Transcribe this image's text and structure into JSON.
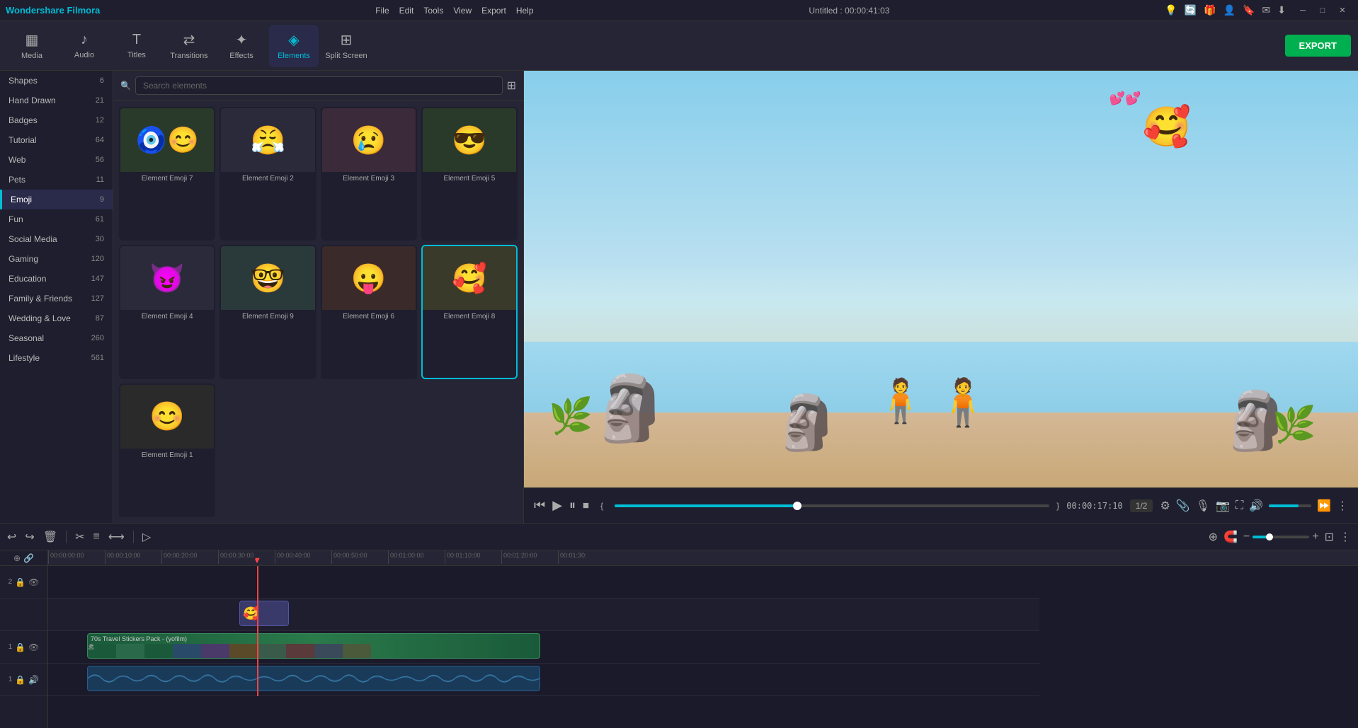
{
  "app": {
    "name": "Wondershare Filmora",
    "title": "Untitled : 00:00:41:03",
    "version": "Filmora"
  },
  "menu": {
    "items": [
      "File",
      "Edit",
      "Tools",
      "View",
      "Export",
      "Help"
    ]
  },
  "toolbar": {
    "items": [
      {
        "id": "media",
        "label": "Media",
        "icon": "▦"
      },
      {
        "id": "audio",
        "label": "Audio",
        "icon": "♪"
      },
      {
        "id": "titles",
        "label": "Titles",
        "icon": "T"
      },
      {
        "id": "transitions",
        "label": "Transitions",
        "icon": "⇄"
      },
      {
        "id": "effects",
        "label": "Effects",
        "icon": "✦"
      },
      {
        "id": "elements",
        "label": "Elements",
        "icon": "◈"
      },
      {
        "id": "splitscreen",
        "label": "Split Screen",
        "icon": "⊞"
      }
    ],
    "active": "elements",
    "export_label": "EXPORT"
  },
  "categories": [
    {
      "id": "shapes",
      "label": "Shapes",
      "count": 6
    },
    {
      "id": "handdrawn",
      "label": "Hand Drawn",
      "count": 21
    },
    {
      "id": "badges",
      "label": "Badges",
      "count": 12
    },
    {
      "id": "tutorial",
      "label": "Tutorial",
      "count": 64
    },
    {
      "id": "web",
      "label": "Web",
      "count": 56
    },
    {
      "id": "pets",
      "label": "Pets",
      "count": 11
    },
    {
      "id": "emoji",
      "label": "Emoji",
      "count": 9,
      "active": true
    },
    {
      "id": "fun",
      "label": "Fun",
      "count": 61
    },
    {
      "id": "socialmedia",
      "label": "Social Media",
      "count": 30
    },
    {
      "id": "gaming",
      "label": "Gaming",
      "count": 120
    },
    {
      "id": "education",
      "label": "Education",
      "count": 147
    },
    {
      "id": "familyfriends",
      "label": "Family & Friends",
      "count": 127
    },
    {
      "id": "weddinglove",
      "label": "Wedding & Love",
      "count": 87
    },
    {
      "id": "seasonal",
      "label": "Seasonal",
      "count": 260
    },
    {
      "id": "lifestyle",
      "label": "Lifestyle",
      "count": 561
    }
  ],
  "search": {
    "placeholder": "Search elements"
  },
  "elements": [
    {
      "id": "emoji7",
      "label": "Element Emoji 7",
      "emoji": "🟠😊",
      "bg": "#2a3a2a"
    },
    {
      "id": "emoji2",
      "label": "Element Emoji 2",
      "emoji": "😤",
      "bg": "#2a2a3a"
    },
    {
      "id": "emoji3",
      "label": "Element Emoji 3",
      "emoji": "😢",
      "bg": "#3a2a3a"
    },
    {
      "id": "emoji5",
      "label": "Element Emoji 5",
      "emoji": "😎",
      "bg": "#2a3a2a"
    },
    {
      "id": "emoji4",
      "label": "Element Emoji 4",
      "emoji": "😈",
      "bg": "#2a2a3a"
    },
    {
      "id": "emoji9",
      "label": "Element Emoji 9",
      "emoji": "🤓",
      "bg": "#2a3a3a"
    },
    {
      "id": "emoji6",
      "label": "Element Emoji 6",
      "emoji": "😛",
      "bg": "#3a2a2a"
    },
    {
      "id": "emoji8",
      "label": "Element Emoji 8",
      "emoji": "🥰",
      "bg": "#3a3a2a",
      "selected": true
    },
    {
      "id": "emoji1",
      "label": "Element Emoji 1",
      "emoji": "😊",
      "bg": "#2a2a2a"
    }
  ],
  "playback": {
    "current_time": "00:00:17:10",
    "total_time": "00:00:41:03",
    "progress_percent": 42,
    "ratio": "1/2"
  },
  "timeline": {
    "toolbar_icons": [
      "↩",
      "↪",
      "🗑",
      "✂",
      "≡",
      "⟷"
    ],
    "time_markers": [
      "00:00:00:00",
      "00:00:10:00",
      "00:00:20:00",
      "00:00:30:00",
      "00:00:40:00",
      "00:00:50:00",
      "00:01:00:00",
      "00:01:10:00",
      "00:01:20:00",
      "00:01:30:"
    ],
    "playhead_position_percent": 21,
    "tracks": [
      {
        "id": "track1",
        "type": "element",
        "icons": [
          "▶",
          "🔒",
          "👁"
        ],
        "label": "2"
      },
      {
        "id": "track2",
        "type": "video",
        "icons": [
          "▶",
          "🔒",
          "👁"
        ],
        "label": "1"
      },
      {
        "id": "track3",
        "type": "audio",
        "icons": [
          "▶",
          "🔒",
          "🔊"
        ],
        "label": "1"
      }
    ],
    "element_clip": {
      "label": "Element Emoji 8",
      "left_percent": 19,
      "width_percent": 5
    },
    "video_clip": {
      "label": "70s Travel Stickers Pack - (yofilm)",
      "left_percent": 4,
      "width_percent": 45
    }
  }
}
